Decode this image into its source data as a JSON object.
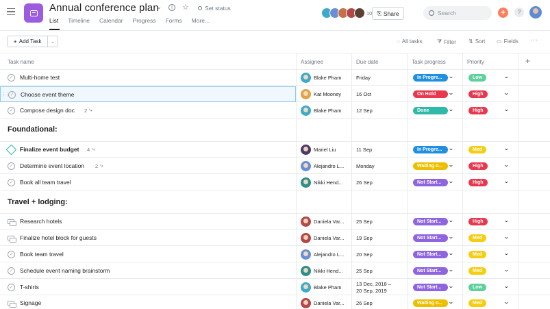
{
  "header": {
    "project_title": "Annual conference plan",
    "set_status": "Set status",
    "tabs": [
      "List",
      "Timeline",
      "Calendar",
      "Progress",
      "Forms",
      "More..."
    ],
    "member_count": "10",
    "share_label": "Share",
    "search_placeholder": "Search",
    "help_label": "?"
  },
  "toolbar": {
    "add_task_label": "Add Task",
    "all_tasks_label": "All tasks",
    "filter_label": "Filter",
    "sort_label": "Sort",
    "fields_label": "Fields"
  },
  "columns": {
    "task_name": "Task name",
    "assignee": "Assignee",
    "due_date": "Due date",
    "task_progress": "Task progress",
    "priority": "Priority"
  },
  "colors": {
    "in_progress": "#1e8fe1",
    "on_hold": "#e8384f",
    "done": "#2fb9a8",
    "waiting": "#ecc000",
    "not_started": "#8f64e0",
    "low": "#5ed09b",
    "high": "#e8384f",
    "med": "#f5cd13"
  },
  "sections": [
    {
      "title": "",
      "tasks": [
        {
          "name": "Multi-home test",
          "assignee": "Blake Pham",
          "due": "Friday",
          "progress": "In Progre...",
          "priority": "Low"
        },
        {
          "name": "Choose event theme",
          "assignee": "Kat Mooney",
          "due": "16 Oct",
          "progress": "On Hold",
          "priority": "High"
        },
        {
          "name": "Compose design doc",
          "subtasks": "2",
          "assignee": "Blake Pham",
          "due": "12 Sep",
          "progress": "Done",
          "priority": "High"
        }
      ]
    },
    {
      "title": "Foundational:",
      "tasks": [
        {
          "name": "Finalize event budget",
          "subtasks": "4",
          "assignee": "Mariel Liu",
          "due": "11 Sep",
          "progress": "In Progre...",
          "priority": "Med"
        },
        {
          "name": "Determine event location",
          "subtasks": "2",
          "assignee": "Alejandro L...",
          "due": "Monday",
          "progress": "Waiting o...",
          "priority": "High"
        },
        {
          "name": "Book all team travel",
          "assignee": "Nikki Hend...",
          "due": "26 Sep",
          "progress": "Not Start...",
          "priority": "High"
        }
      ]
    },
    {
      "title": "Travel + lodging:",
      "tasks": [
        {
          "name": "Research hotels",
          "assignee": "Daniela Var...",
          "due": "25 Sep",
          "progress": "Not Start...",
          "priority": "High"
        },
        {
          "name": "Finalize hotel block for guests",
          "assignee": "Daniela Var...",
          "due": "19 Sep",
          "progress": "Not Start...",
          "priority": "Med"
        },
        {
          "name": "Book team travel",
          "assignee": "Alejandro L...",
          "due": "20 Sep",
          "progress": "Not Start...",
          "priority": "Med"
        },
        {
          "name": "Schedule event naming brainstorm",
          "assignee": "Nikki Hend...",
          "due": "25 Sep",
          "progress": "Not Start...",
          "priority": "Med"
        },
        {
          "name": "T-shirts",
          "assignee": "Blake Pham",
          "due": "13 Dec, 2018 –",
          "due2": "20 Sep, 2019",
          "progress": "Not Start...",
          "priority": "Low"
        },
        {
          "name": "Signage",
          "assignee": "Daniela Var...",
          "due": "26 Sep",
          "progress": "Waiting o...",
          "priority": "Med"
        }
      ]
    }
  ]
}
